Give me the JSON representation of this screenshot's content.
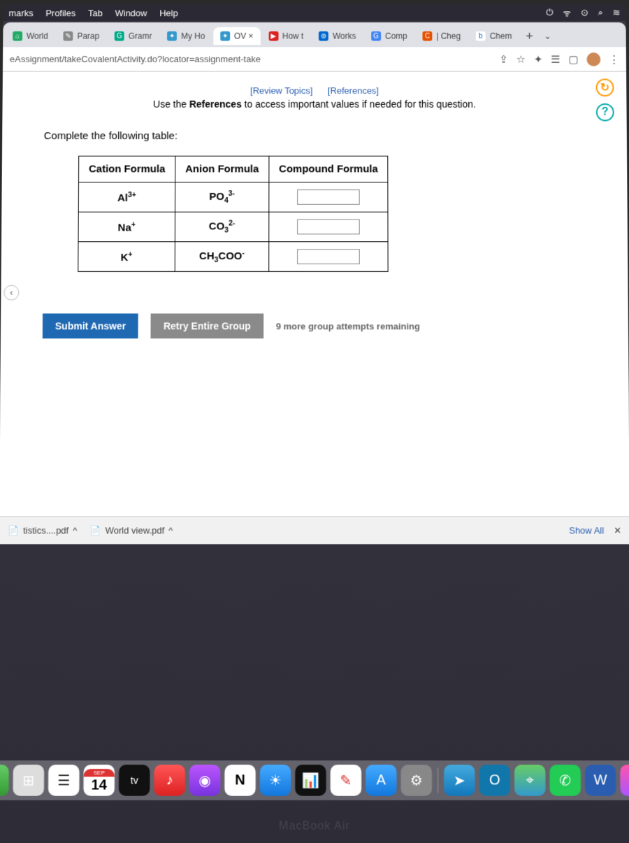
{
  "mac_menu": {
    "items": [
      "marks",
      "Profiles",
      "Tab",
      "Window",
      "Help"
    ]
  },
  "tabs": [
    {
      "label": "World"
    },
    {
      "label": "Parap"
    },
    {
      "label": "Gramr"
    },
    {
      "label": "My Ho"
    },
    {
      "label": "OV ×",
      "active": true
    },
    {
      "label": "How t"
    },
    {
      "label": "Works"
    },
    {
      "label": "Comp"
    },
    {
      "label": "| Cheg"
    },
    {
      "label": "Chem"
    }
  ],
  "address": "eAssignment/takeCovalentActivity.do?locator=assignment-take",
  "links": {
    "review": "[Review Topics]",
    "references": "[References]"
  },
  "instruction": "Use the References to access important values if needed for this question.",
  "prompt": "Complete the following table:",
  "headers": {
    "cation": "Cation Formula",
    "anion": "Anion Formula",
    "compound": "Compound Formula"
  },
  "rows": [
    {
      "cation_base": "Al",
      "cation_sup": "3+",
      "anion_base": "PO",
      "anion_sub": "4",
      "anion_sup": "3-",
      "compound": ""
    },
    {
      "cation_base": "Na",
      "cation_sup": "+",
      "anion_base": "CO",
      "anion_sub": "3",
      "anion_sup": "2-",
      "compound": ""
    },
    {
      "cation_base": "K",
      "cation_sup": "+",
      "anion_base": "CH",
      "anion_sub": "3",
      "anion_extra": "COO",
      "anion_sup": "-",
      "compound": ""
    }
  ],
  "buttons": {
    "submit": "Submit Answer",
    "retry": "Retry Entire Group"
  },
  "attempts": "9 more group attempts remaining",
  "downloads": {
    "item1": "tistics....pdf",
    "item2": "World view.pdf",
    "show_all": "Show All"
  },
  "calendar": {
    "month": "SEP",
    "day": "14"
  },
  "laptop": "MacBook Air",
  "chart_data": {
    "type": "table",
    "title": "Complete the following table:",
    "columns": [
      "Cation Formula",
      "Anion Formula",
      "Compound Formula"
    ],
    "rows": [
      [
        "Al3+",
        "PO4 3-",
        ""
      ],
      [
        "Na+",
        "CO3 2-",
        ""
      ],
      [
        "K+",
        "CH3COO-",
        ""
      ]
    ]
  }
}
